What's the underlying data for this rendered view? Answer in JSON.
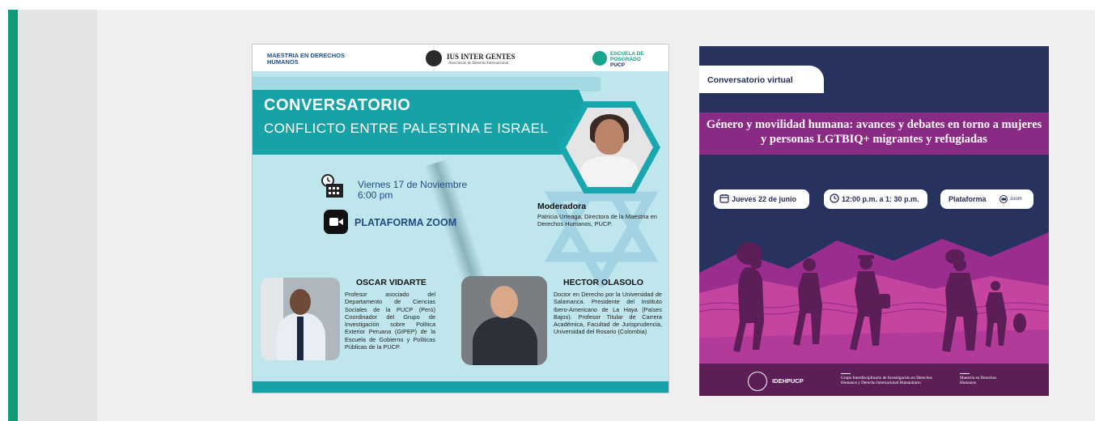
{
  "poster_left": {
    "header": {
      "maestria": "MAESTRIA EN DERECHOS HUMANOS",
      "ius_title": "IUS INTER GENTES",
      "ius_subtitle": "Asociación de Derecho Internacional",
      "escuela": "ESCUELA DE POSGRADO",
      "pucp": "PUCP"
    },
    "title": "CONVERSATORIO",
    "subtitle": "CONFLICTO ENTRE PALESTINA E ISRAEL",
    "date": "Viernes 17 de Noviembre",
    "time": "6:00 pm",
    "platform": "PLATAFORMA ZOOM",
    "moderator_title": "Moderadora",
    "moderator_desc": "Patricia Urteaga, Directora de la Maestria en Derechos Humanos, PUCP.",
    "speaker1_name": "OSCAR VIDARTE",
    "speaker1_desc": "Profesor asociado del Departamento de Ciencias Sociales de la PUCP (Perú) Coordinador del Grupo de Investigación sobre Política Exterior Peruana (GIPEP) de la Escuela de Gobierno y Políticas Públicas de la PUCP.",
    "speaker2_name": "HECTOR OLASOLO",
    "speaker2_desc": "Doctor en Derecho por la Universidad de Salamanca. Presidente del Instituto Ibero-Americano de La Haya (Países Bajos). Profesor Titular de Carrera Académica, Facultad de Jurisprudencia, Universidad del Rosario (Colombia)",
    "colors": {
      "teal": "#17a2a8",
      "navy_text": "#1e4d86",
      "background": "#bfe6ec"
    }
  },
  "poster_right": {
    "tab_label": "Conversatorio virtual",
    "title": "Género y movilidad humana: avances y debates en torno a mujeres y personas LGTBIQ+ migrantes y refugiadas",
    "date": "Jueves 22 de junio",
    "time": "12:00 p.m. a 1: 30 p.m.",
    "platform": "Plataforma",
    "platform_brand": "zoom",
    "footer_idehpucp": "IDEHPUCP",
    "footer_group": "Grupo Interdisciplinario de Investigación en Derechos Humanos y Derecho Internacional Humanitario",
    "footer_maestria": "Maestría en Derechos Humanos",
    "colors": {
      "navy": "#27325e",
      "magenta": "#8b2a85",
      "pink": "#d44fb4"
    }
  },
  "icons": [
    "calendar-icon",
    "zoom-camera-icon",
    "clock-icon",
    "globe-logo-icon"
  ]
}
